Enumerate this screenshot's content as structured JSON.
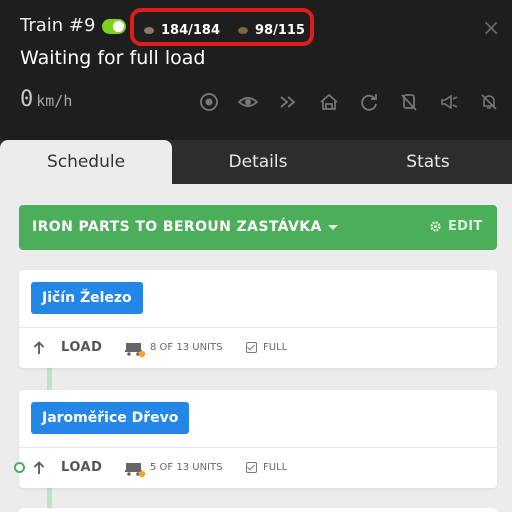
{
  "header": {
    "train_name": "Train #9",
    "status": "Waiting for full load",
    "speed_value": "0",
    "speed_unit": "km/h",
    "cargo": [
      {
        "amount": "184/184",
        "color": "#7a6a5a",
        "icon": "iron-ore-icon"
      },
      {
        "amount": "98/115",
        "color": "#6b5a45",
        "icon": "wood-icon"
      }
    ],
    "close_label": "×",
    "toolbar_icons": [
      "target-icon",
      "eye-icon",
      "fast-forward-icon",
      "depot-icon",
      "refresh-icon",
      "no-unload-icon",
      "horn-icon",
      "mute-bell-icon"
    ]
  },
  "tabs": [
    {
      "label": "Schedule",
      "active": true
    },
    {
      "label": "Details",
      "active": false
    },
    {
      "label": "Stats",
      "active": false
    }
  ],
  "route": {
    "name": "IRON PARTS TO BEROUN ZASTÁVKA",
    "edit_label": "EDIT"
  },
  "stops": [
    {
      "station": "Jičín Železo",
      "action": "LOAD",
      "units": "8 OF 13 UNITS",
      "condition": "FULL"
    },
    {
      "station": "Jaroměřice Dřevo",
      "action": "LOAD",
      "units": "5 OF 13 UNITS",
      "condition": "FULL"
    }
  ],
  "colors": {
    "header_bg": "#1e1e1e",
    "route_green": "#4cae5a",
    "station_blue": "#2486e7",
    "toggle_green": "#7ed321",
    "highlight_red": "#e01b1b"
  }
}
